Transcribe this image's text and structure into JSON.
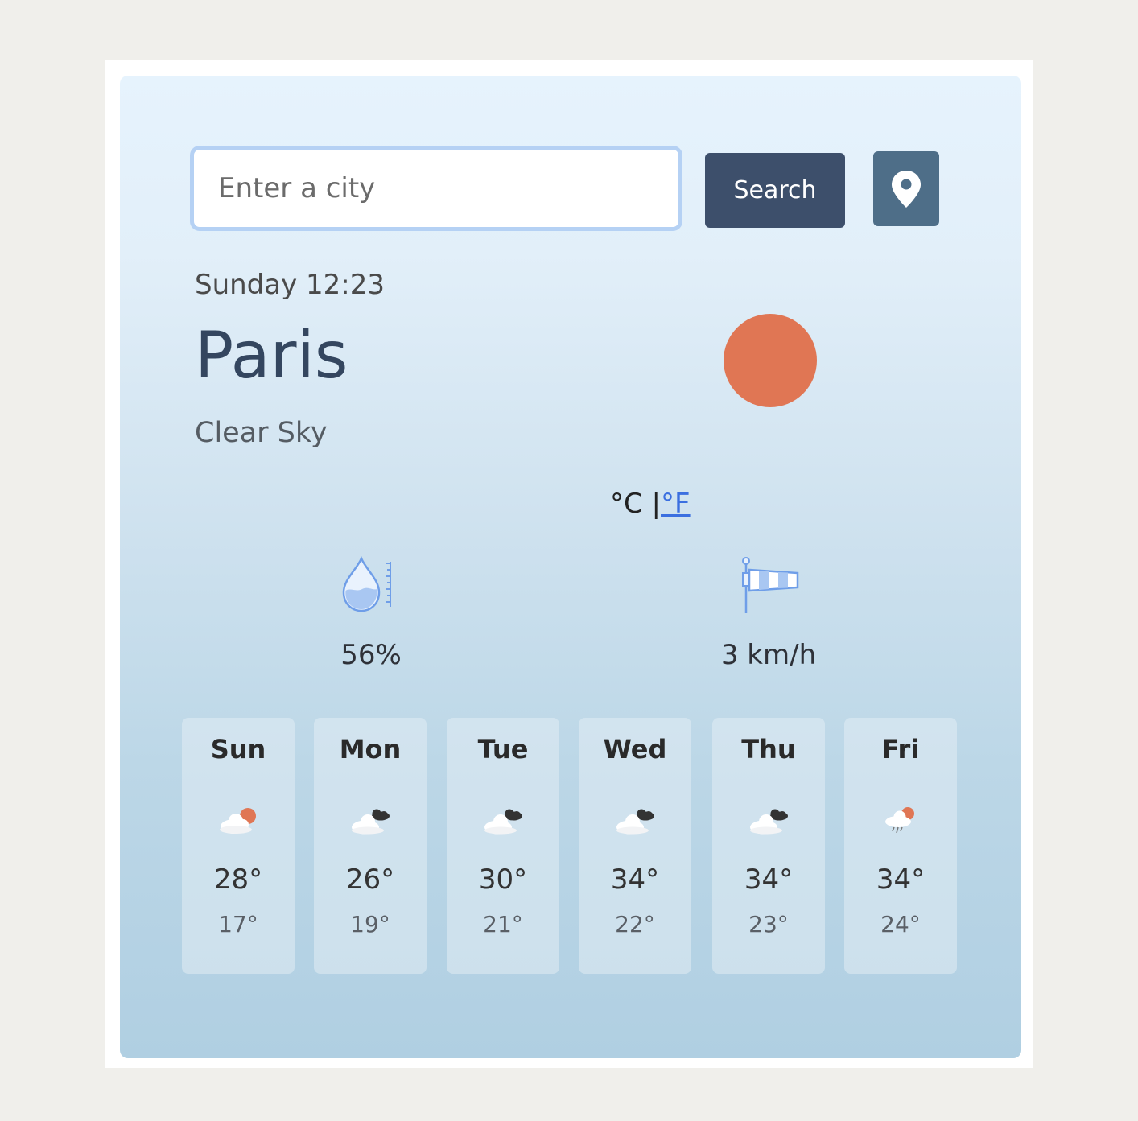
{
  "search": {
    "placeholder": "Enter a city",
    "button_label": "Search"
  },
  "current": {
    "datetime": "Sunday 12:23",
    "city": "Paris",
    "description": "Clear Sky",
    "icon": "clear-sky-sun-icon",
    "units_celsius": "°C |",
    "units_fahrenheit": "°F",
    "humidity": "56%",
    "wind": "3 km/h"
  },
  "forecast": [
    {
      "day": "Sun",
      "icon": "partly-cloudy-sun-icon",
      "max": "28°",
      "min": "17°"
    },
    {
      "day": "Mon",
      "icon": "broken-clouds-icon",
      "max": "26°",
      "min": "19°"
    },
    {
      "day": "Tue",
      "icon": "broken-clouds-icon",
      "max": "30°",
      "min": "21°"
    },
    {
      "day": "Wed",
      "icon": "broken-clouds-icon",
      "max": "34°",
      "min": "22°"
    },
    {
      "day": "Thu",
      "icon": "broken-clouds-icon",
      "max": "34°",
      "min": "23°"
    },
    {
      "day": "Fri",
      "icon": "rain-sun-icon",
      "max": "34°",
      "min": "24°"
    }
  ],
  "colors": {
    "accent_sun": "#e07654",
    "search_button": "#3d4f6b",
    "location_button": "#4e6e88",
    "icon_blue": "#6f9ee8"
  }
}
